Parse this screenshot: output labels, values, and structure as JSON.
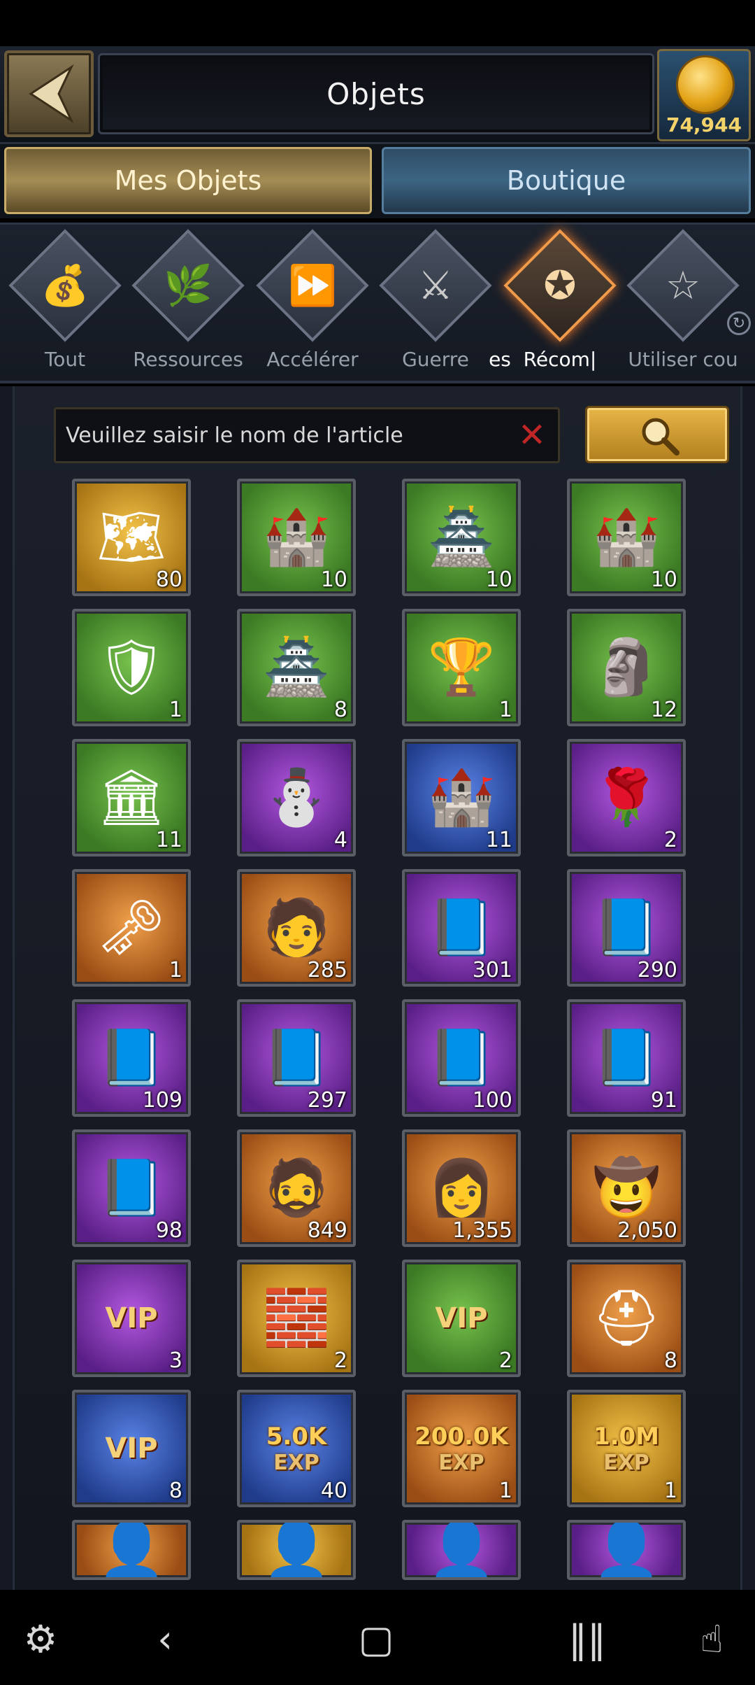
{
  "header": {
    "title": "Objets",
    "coins": "74,944"
  },
  "tabs": [
    {
      "label": "Mes Objets"
    },
    {
      "label": "Boutique"
    }
  ],
  "categories": [
    {
      "label": "Tout",
      "icon": "bag-icon"
    },
    {
      "label": "Ressources",
      "icon": "leaf-icon"
    },
    {
      "label": "Accélérer",
      "icon": "fast-forward-icon"
    },
    {
      "label": "Guerre",
      "icon": "crossed-swords-icon"
    },
    {
      "label": "es",
      "icon": ""
    },
    {
      "label": "Récom|",
      "icon": "star-badge-icon",
      "active": true
    },
    {
      "label": "Utiliser cou",
      "icon": "star-icon"
    }
  ],
  "search": {
    "placeholder": "Veuillez saisir le nom de l'article"
  },
  "items": [
    {
      "qty": "80",
      "bg": "gold",
      "icon": "map-scroll-icon"
    },
    {
      "qty": "10",
      "bg": "green",
      "icon": "castle-skin-icon"
    },
    {
      "qty": "10",
      "bg": "green",
      "icon": "winter-castle-icon"
    },
    {
      "qty": "10",
      "bg": "green",
      "icon": "rose-castle-icon"
    },
    {
      "qty": "1",
      "bg": "green",
      "icon": "armor-skin-icon"
    },
    {
      "qty": "8",
      "bg": "green",
      "icon": "golden-castle-icon"
    },
    {
      "qty": "1",
      "bg": "green",
      "icon": "trophy-scroll-icon"
    },
    {
      "qty": "12",
      "bg": "green",
      "icon": "golden-statue-icon"
    },
    {
      "qty": "11",
      "bg": "green",
      "icon": "statue-plaza-icon"
    },
    {
      "qty": "4",
      "bg": "purple",
      "icon": "snowman-icon"
    },
    {
      "qty": "11",
      "bg": "blue",
      "icon": "fortress-icon"
    },
    {
      "qty": "2",
      "bg": "purple",
      "icon": "rose-icon"
    },
    {
      "qty": "1",
      "bg": "orange",
      "icon": "key-icon"
    },
    {
      "qty": "285",
      "bg": "orange",
      "icon": "knight-portrait-icon"
    },
    {
      "qty": "301",
      "bg": "purple",
      "icon": "tome-icon"
    },
    {
      "qty": "290",
      "bg": "purple",
      "icon": "tome-icon"
    },
    {
      "qty": "109",
      "bg": "purple",
      "icon": "tome-icon"
    },
    {
      "qty": "297",
      "bg": "purple",
      "icon": "tome-icon"
    },
    {
      "qty": "100",
      "bg": "purple",
      "icon": "tome-icon"
    },
    {
      "qty": "91",
      "bg": "purple",
      "icon": "tome-icon"
    },
    {
      "qty": "98",
      "bg": "purple",
      "icon": "tome-icon"
    },
    {
      "qty": "849",
      "bg": "orange",
      "icon": "hero-portrait-icon"
    },
    {
      "qty": "1,355",
      "bg": "orange",
      "icon": "lady-portrait-icon"
    },
    {
      "qty": "2,050",
      "bg": "orange",
      "icon": "hat-portrait-icon"
    },
    {
      "qty": "3",
      "bg": "purple",
      "icon": "vip-badge-icon"
    },
    {
      "qty": "2",
      "bg": "gold",
      "icon": "wall-upgrade-icon"
    },
    {
      "qty": "2",
      "bg": "green",
      "icon": "vip-badge-icon"
    },
    {
      "qty": "8",
      "bg": "orange",
      "icon": "helmet-upgrade-icon"
    },
    {
      "qty": "8",
      "bg": "blue",
      "icon": "vip-badge-icon"
    },
    {
      "qty": "40",
      "bg": "blue",
      "icon": "exp-5k-icon",
      "label": "5.0K"
    },
    {
      "qty": "1",
      "bg": "orange",
      "icon": "exp-200k-icon",
      "label": "200.0K"
    },
    {
      "qty": "1",
      "bg": "gold",
      "icon": "exp-1m-icon",
      "label": "1.0M"
    },
    {
      "qty": "",
      "bg": "orange",
      "icon": "portrait-icon"
    },
    {
      "qty": "",
      "bg": "gold",
      "icon": "portrait-icon"
    },
    {
      "qty": "",
      "bg": "purple",
      "icon": "portrait-icon"
    },
    {
      "qty": "",
      "bg": "purple",
      "icon": "portrait-icon"
    }
  ]
}
